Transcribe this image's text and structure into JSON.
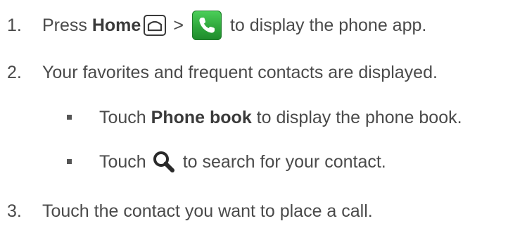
{
  "steps": [
    {
      "number": "1.",
      "text_before": "Press ",
      "bold": "Home",
      "separator": ">",
      "text_after": "to display the phone app."
    },
    {
      "number": "2.",
      "text": "Your favorites and frequent contacts are displayed."
    },
    {
      "number": "3.",
      "text": "Touch the contact you want to place a call."
    }
  ],
  "sub_bullets": [
    {
      "text_before": "Touch ",
      "bold": "Phone book",
      "text_after": " to display the phone book."
    },
    {
      "text_before": "Touch",
      "text_after": "to search for your contact."
    }
  ],
  "icons": {
    "home": "home-icon",
    "phone_app": "phone-app-icon",
    "search": "search-icon"
  },
  "colors": {
    "text": "#4a4a4a",
    "phone_app_green": "#2fa83c"
  }
}
